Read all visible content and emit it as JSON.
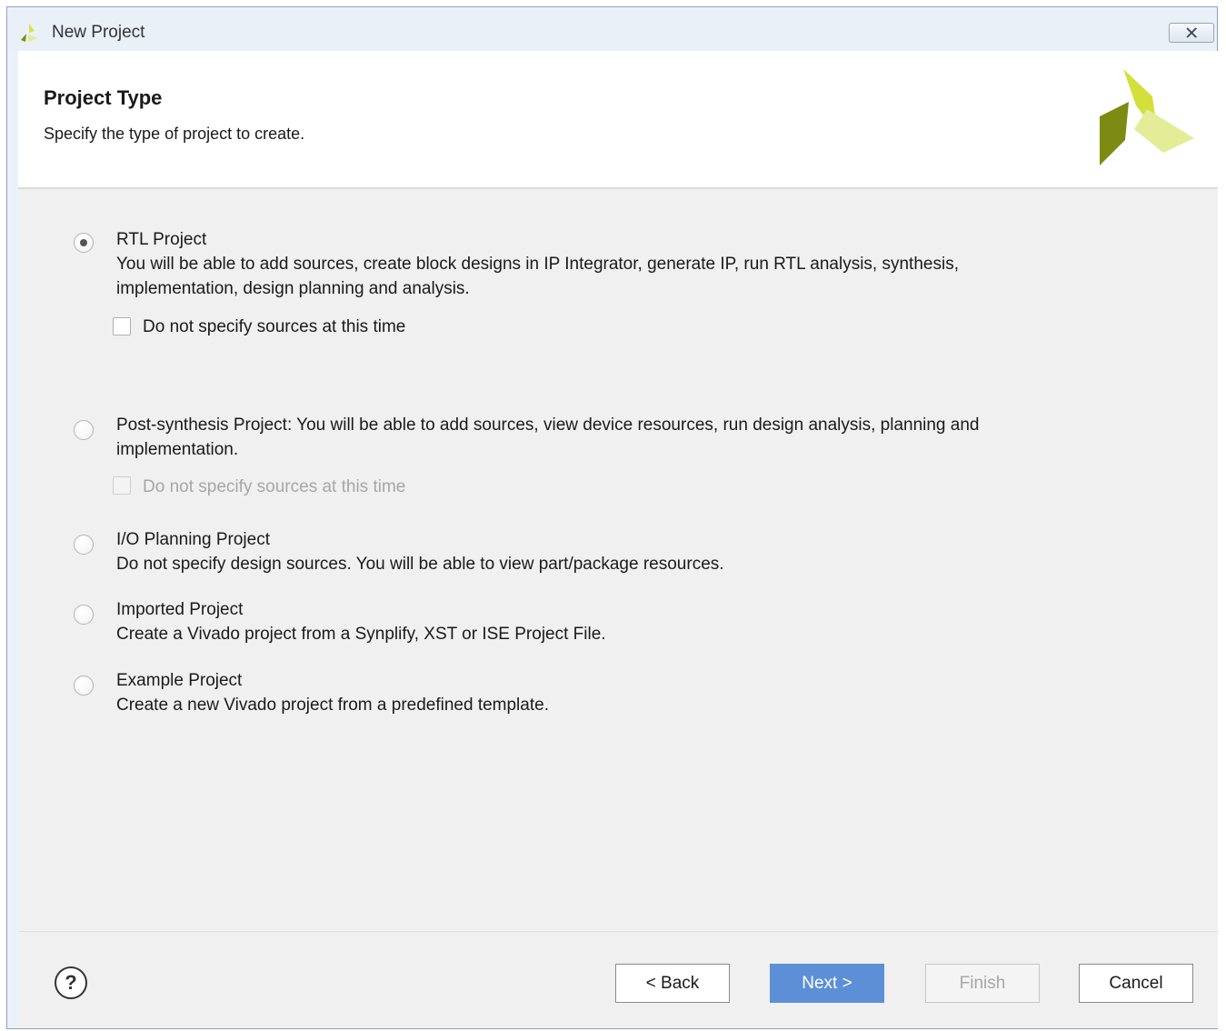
{
  "window": {
    "title": "New Project"
  },
  "header": {
    "title": "Project Type",
    "subtitle": "Specify the type of project to create."
  },
  "options": [
    {
      "label": "RTL Project",
      "selected": true,
      "description_lines": [
        "You will be able to add sources, create block designs in IP Integrator, generate IP, run RTL analysis, synthesis,",
        "implementation, design planning and analysis."
      ],
      "sub_checkbox": {
        "label": "Do not specify sources at this time",
        "checked": false,
        "enabled": true
      }
    },
    {
      "label": "Post-synthesis Project: You will be able to add sources, view device resources, run design analysis, planning and",
      "selected": false,
      "description_lines": [
        "implementation."
      ],
      "sub_checkbox": {
        "label": "Do not specify sources at this time",
        "checked": false,
        "enabled": false
      }
    },
    {
      "label": "I/O Planning Project",
      "selected": false,
      "description_lines": [
        "Do not specify design sources. You will be able to view part/package resources."
      ]
    },
    {
      "label": "Imported Project",
      "selected": false,
      "description_lines": [
        "Create a Vivado project from a Synplify, XST or ISE Project File."
      ]
    },
    {
      "label": "Example Project",
      "selected": false,
      "description_lines": [
        "Create a new Vivado project from a predefined template."
      ]
    }
  ],
  "footer": {
    "help_label": "?",
    "back_label": "< Back",
    "next_label": "Next >",
    "finish_label": "Finish",
    "cancel_label": "Cancel"
  },
  "colors": {
    "accent": "#5d8fd6",
    "logo_light": "#d9e86a",
    "logo_dark": "#8a9a1a"
  }
}
